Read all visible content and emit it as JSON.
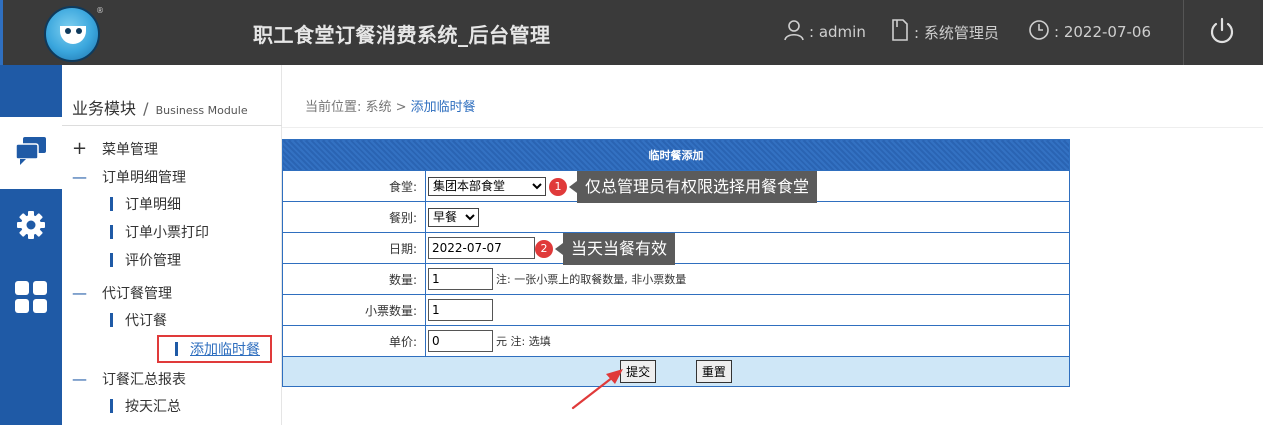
{
  "header": {
    "app_title": "职工食堂订餐消费系统_后台管理",
    "user_label": ":  admin",
    "role_label": ":  系统管理员",
    "date_label": ":  2022-07-06",
    "user_icon": "person-icon",
    "role_icon": "document-icon",
    "date_icon": "clock-icon",
    "power_icon": "power-icon",
    "logo_mark": "®"
  },
  "rail": {
    "items": [
      {
        "icon": "chat-bubbles-icon",
        "active": true
      },
      {
        "icon": "gear-icon",
        "active": false
      },
      {
        "icon": "grid-icon",
        "active": false
      }
    ]
  },
  "sidebar": {
    "heading": "业务模块",
    "heading_sep": "/",
    "heading_en": "Business Module",
    "menus": [
      {
        "mark": "+",
        "label": "菜单管理"
      },
      {
        "mark": "—",
        "label": "订单明细管理"
      },
      {
        "mark": "—",
        "label": "代订餐管理"
      },
      {
        "mark": "—",
        "label": "订餐汇总报表"
      }
    ],
    "subs": {
      "order_detail": "订单明细",
      "order_ticket_print": "订单小票打印",
      "review_manage": "评价管理",
      "proxy_order": "代订餐",
      "add_temp_meal": "添加临时餐",
      "daily_summary": "按天汇总"
    }
  },
  "breadcrumb": {
    "prefix": "当前位置: 系统 > ",
    "current": "添加临时餐"
  },
  "form": {
    "title": "临时餐添加",
    "fields": {
      "canteen_label": "食堂:",
      "canteen_value": "集团本部食堂",
      "meal_label": "餐别:",
      "meal_value": "早餐",
      "date_label": "日期:",
      "date_value": "2022-07-07",
      "qty_label": "数量:",
      "qty_value": "1",
      "qty_note": "注: 一张小票上的取餐数量, 非小票数量",
      "tickets_label": "小票数量:",
      "tickets_value": "1",
      "price_label": "单价:",
      "price_value": "0",
      "price_note": "元 注: 选填"
    },
    "submit_label": "提交",
    "reset_label": "重置"
  },
  "annotations": {
    "badge1": "1",
    "tip1": "仅总管理员有权限选择用餐食堂",
    "badge2": "2",
    "tip2": "当天当餐有效",
    "arrow_color": "#e03a3a"
  }
}
